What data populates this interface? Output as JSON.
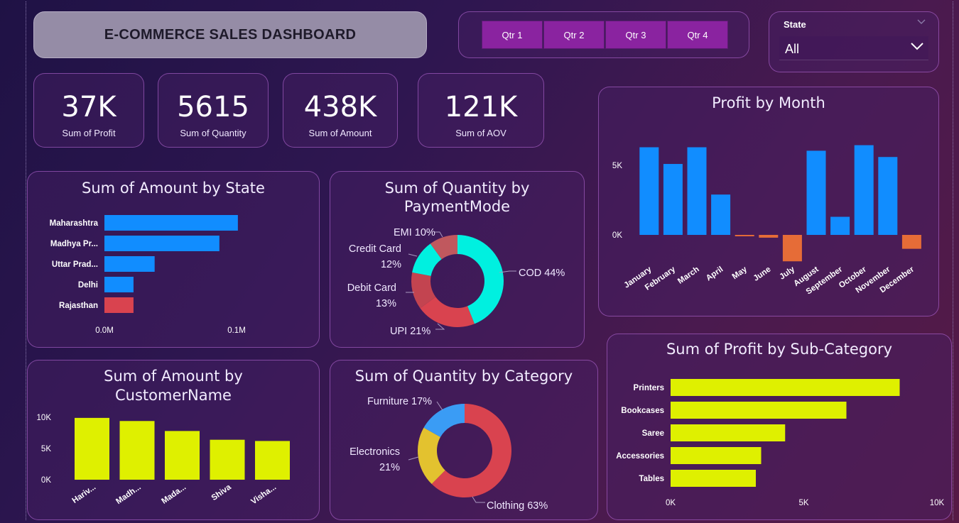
{
  "dashboard_title": "E-COMMERCE SALES DASHBOARD",
  "quarter_slicer": [
    "Qtr 1",
    "Qtr 2",
    "Qtr 3",
    "Qtr 4"
  ],
  "state_filter": {
    "label": "State",
    "value": "All"
  },
  "kpis": [
    {
      "value": "37K",
      "label": "Sum of Profit"
    },
    {
      "value": "5615",
      "label": "Sum of Quantity"
    },
    {
      "value": "438K",
      "label": "Sum of Amount"
    },
    {
      "value": "121K",
      "label": "Sum of AOV"
    }
  ],
  "colors": {
    "blue": "#118dff",
    "red": "#d9434f",
    "orange": "#e66c37",
    "lime": "#dff000",
    "cyan": "#00f0e0",
    "furniture": "#3a9cf5",
    "electronics": "#e3c22f",
    "emi": "#c0585e",
    "debit": "#c34450"
  },
  "titles": {
    "amount_by_state": "Sum of Amount by State",
    "qty_by_payment_line1": "Sum of Quantity by",
    "qty_by_payment_line2": "PaymentMode",
    "profit_by_month": "Profit by Month",
    "amount_by_customer_line1": "Sum of Amount by",
    "amount_by_customer_line2": "CustomerName",
    "qty_by_category": "Sum of Quantity by Category",
    "profit_by_subcategory": "Sum of Profit by Sub-Category"
  },
  "chart_data": [
    {
      "id": "amount_by_state",
      "type": "bar",
      "orientation": "horizontal",
      "title": "Sum of Amount by State",
      "categories": [
        "Maharashtra",
        "Madhya Pr...",
        "Uttar Prad...",
        "Delhi",
        "Rajasthan"
      ],
      "values": [
        0.101,
        0.087,
        0.038,
        0.022,
        0.022
      ],
      "highlight": [
        false,
        false,
        false,
        false,
        true
      ],
      "xticks": [
        "0.0M",
        "0.1M"
      ],
      "xlim": [
        0,
        0.1
      ]
    },
    {
      "id": "qty_by_payment",
      "type": "pie",
      "title": "Sum of Quantity by PaymentMode",
      "slices": [
        {
          "name": "COD",
          "value": 44,
          "label": "COD 44%"
        },
        {
          "name": "UPI",
          "value": 21,
          "label": "UPI 21%"
        },
        {
          "name": "Debit Card",
          "value": 13,
          "label_line1": "Debit Card",
          "label_line2": "13%"
        },
        {
          "name": "Credit Card",
          "value": 12,
          "label_line1": "Credit Card",
          "label_line2": "12%"
        },
        {
          "name": "EMI",
          "value": 10,
          "label": "EMI 10%"
        }
      ]
    },
    {
      "id": "profit_by_month",
      "type": "bar",
      "title": "Profit by Month",
      "categories": [
        "January",
        "February",
        "March",
        "April",
        "May",
        "June",
        "July",
        "August",
        "September",
        "October",
        "November",
        "December"
      ],
      "values": [
        6300,
        5100,
        6300,
        2900,
        -100,
        -200,
        -1900,
        6050,
        1300,
        6450,
        5600,
        -1000
      ],
      "yticks": [
        "0K",
        "5K"
      ],
      "ylim": [
        -2100,
        7600
      ]
    },
    {
      "id": "amount_by_customer",
      "type": "bar",
      "title": "Sum of Amount by CustomerName",
      "categories": [
        "Hariv...",
        "Madh...",
        "Mada...",
        "Shiva",
        "Visha..."
      ],
      "values": [
        9900,
        9400,
        7800,
        6400,
        6200
      ],
      "yticks": [
        "0K",
        "5K",
        "10K"
      ],
      "ylim": [
        0,
        10000
      ]
    },
    {
      "id": "qty_by_category",
      "type": "pie",
      "title": "Sum of Quantity by Category",
      "slices": [
        {
          "name": "Clothing",
          "value": 63,
          "label": "Clothing 63%"
        },
        {
          "name": "Electronics",
          "value": 21,
          "label_line1": "Electronics",
          "label_line2": "21%"
        },
        {
          "name": "Furniture",
          "value": 17,
          "label": "Furniture 17%"
        }
      ]
    },
    {
      "id": "profit_by_subcategory",
      "type": "bar",
      "orientation": "horizontal",
      "title": "Sum of Profit by Sub-Category",
      "categories": [
        "Printers",
        "Bookcases",
        "Saree",
        "Accessories",
        "Tables"
      ],
      "values": [
        8600,
        6600,
        4300,
        3400,
        3200
      ],
      "xticks": [
        "0K",
        "5K",
        "10K"
      ],
      "xlim": [
        0,
        10000
      ]
    }
  ]
}
